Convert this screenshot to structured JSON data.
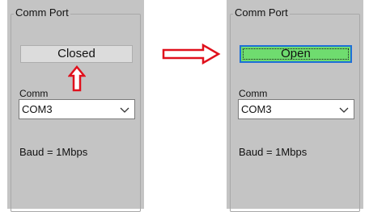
{
  "left_panel": {
    "group_title": "Comm Port",
    "port_button_label": "Closed",
    "comm_label": "Comm",
    "comm_selected": "COM3",
    "baud_text": "Baud = 1Mbps"
  },
  "right_panel": {
    "group_title": "Comm Port",
    "port_button_label": "Open",
    "comm_label": "Comm",
    "comm_selected": "COM3",
    "baud_text": "Baud = 1Mbps"
  },
  "icons": {
    "transition_arrow": "right-arrow-icon",
    "pointer_arrow": "up-arrow-icon",
    "dropdown": "chevron-down-icon"
  },
  "colors": {
    "panel_bg": "#c4c4c4",
    "open_button_bg": "#6fdc6f",
    "open_button_border": "#1e6fd8",
    "annotation_arrow": "#e0101c"
  }
}
